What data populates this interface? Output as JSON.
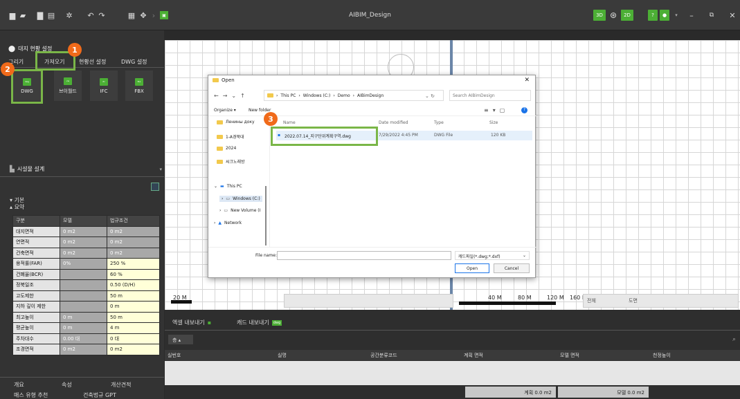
{
  "app": {
    "title": "AIBIM_Design",
    "btn_3d": "3D",
    "btn_2d": "2D",
    "btn_help": "?"
  },
  "icons": {
    "new": "file-icon",
    "open": "folder-icon",
    "save": "save-icon",
    "saveas": "save-as-icon",
    "settings": "gear-icon",
    "undo": "undo-icon",
    "redo": "redo-icon",
    "grid": "grid-icon",
    "move": "move-icon",
    "minimize": "minimize-icon",
    "restore": "restore-icon",
    "close": "close-icon"
  },
  "left": {
    "site_header": "대지 현황 설정",
    "tabs": [
      "그리기",
      "가져오기",
      "현황선 설정",
      "DWG 설정"
    ],
    "tools": [
      {
        "label": "DWG",
        "icon": "dwg"
      },
      {
        "label": "브이월드",
        "icon": "vw"
      },
      {
        "label": "IFC",
        "icon": "ifc"
      },
      {
        "label": "FBX",
        "icon": "fbx"
      }
    ],
    "facility_header": "시설물 설계",
    "basic_label": "기본",
    "summary_label": "요약",
    "table_headers": [
      "구분",
      "모델",
      "법규조건"
    ],
    "table_rows": [
      [
        "대지면적",
        "0 m2",
        "0 m2"
      ],
      [
        "연면적",
        "0 m2",
        "0 m2"
      ],
      [
        "건축면적",
        "0 m2",
        "0 m2"
      ],
      [
        "용적률(FAR)",
        "0%",
        "250 %"
      ],
      [
        "건폐율(BCR)",
        "",
        "60 %"
      ],
      [
        "정북일조",
        "",
        "0.50 (D/H)"
      ],
      [
        "고도제한",
        "",
        "50 m"
      ],
      [
        "지하 깊이 제한",
        "",
        "0 m"
      ],
      [
        "최고높이",
        "0 m",
        "50 m"
      ],
      [
        "평균높이",
        "0 m",
        "4 m"
      ],
      [
        "주차대수",
        "0.00 대",
        "0 대"
      ],
      [
        "조경면적",
        "0 m2",
        "0 m2"
      ]
    ],
    "bottom_tabs": [
      "개요",
      "속성",
      "개산견적"
    ],
    "bottom_tabs2": [
      "매스 유형 추천",
      "건축법규 GPT"
    ]
  },
  "callouts": [
    "1",
    "2",
    "3"
  ],
  "scale": {
    "left": "20 M",
    "right_40": "40 M",
    "right_80": "80 M",
    "right_120": "120 M",
    "right_160": "160 M"
  },
  "view_toolbar": {
    "all": "전체",
    "drawing": "도면"
  },
  "bottom": {
    "tab_excel": "엑셀 내보내기",
    "tab_cad": "캐드 내보내기",
    "floor_label": "층",
    "columns": [
      "실번호",
      "실명",
      "공간분류코드",
      "계획 면적",
      "모델 면적",
      "천정높이"
    ],
    "plan_area": "계획 0.0 m2",
    "model_area": "모델 0.0 m2"
  },
  "dialog": {
    "title": "Open",
    "breadcrumb": [
      "This PC",
      "Windows (C:)",
      "Demo",
      "AIBimDesign"
    ],
    "search_placeholder": "Search AIBimDesign",
    "organize": "Organize ▾",
    "new_folder": "New folder",
    "nav_items": [
      "Ленины доку",
      "1-A경북대",
      "2024",
      "씨크노래방"
    ],
    "this_pc": "This PC",
    "pc_items": [
      "Windows (C:)",
      "New Volume (I"
    ],
    "network": "Network",
    "columns": [
      "Name",
      "Date modified",
      "Type",
      "Size"
    ],
    "file": {
      "name": "2022.07.14_지구단위계획구역.dwg",
      "date": "7/29/2022 4:45 PM",
      "type": "DWG File",
      "size": "120 KB"
    },
    "filename_label": "File name:",
    "filter": "캐드파일(*.dwg;*.dxf)",
    "open_btn": "Open",
    "cancel_btn": "Cancel"
  }
}
